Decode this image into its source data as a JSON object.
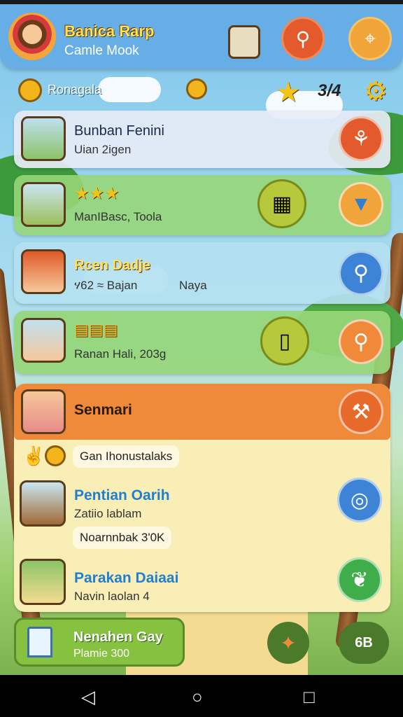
{
  "header": {
    "title": "Banica Rarp",
    "subtitle": "Camle Mook"
  },
  "currency": {
    "label": "Ronagala",
    "counter": "3/4"
  },
  "cards": [
    {
      "title": "Bunban Fenini",
      "subtitle": "Uian 2igen"
    },
    {
      "title": "",
      "subtitle": "ManIBasc, Toola"
    },
    {
      "title": "Rcen Dadje",
      "subtitle": "ሃ62 ≈ Bajan",
      "extra": "Naya"
    },
    {
      "title": "",
      "subtitle": "Ranan Hali, 203g"
    }
  ],
  "panel": {
    "header": "Senmari",
    "badge_text": "Gan Ihonustalaks",
    "items": [
      {
        "title": "Pentian Oarih",
        "subtitle": "Zatiio lablam",
        "tag": "Noarnnbak 3'0K"
      },
      {
        "title": "Parakan Daiaai",
        "subtitle": "Navin laolan 4"
      }
    ]
  },
  "bottom": {
    "title": "Nenahen Gay",
    "subtitle": "Plamie 300",
    "right_label": "6B"
  },
  "colors": {
    "header_bg": "#67aee6",
    "orange": "#ee8a3a",
    "blue_action": "#3d84d6",
    "green_action": "#3fae4a"
  }
}
